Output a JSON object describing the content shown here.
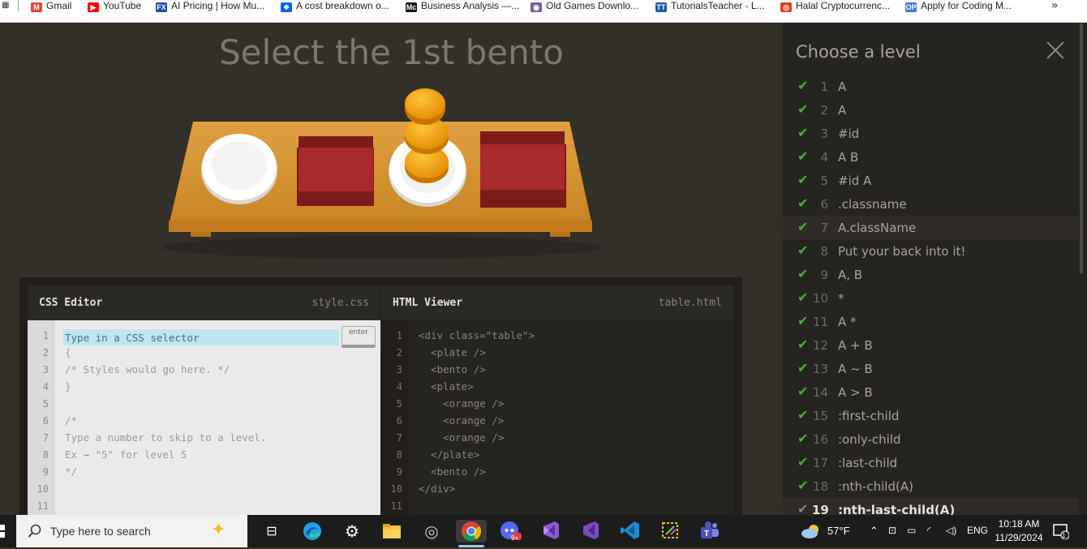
{
  "bookmarks": [
    {
      "label": "Gmail",
      "icon": "gmail-icon",
      "color": "#ea4335",
      "glyph": "M"
    },
    {
      "label": "YouTube",
      "icon": "youtube-icon",
      "color": "#ff0000",
      "glyph": "▶"
    },
    {
      "label": "AI Pricing | How Mu...",
      "icon": "fx-icon",
      "color": "#1a4fa0",
      "glyph": "FX"
    },
    {
      "label": "A cost breakdown o...",
      "icon": "dropbox-icon",
      "color": "#0061fe",
      "glyph": "❖"
    },
    {
      "label": "Business Analysis —...",
      "icon": "mc-icon",
      "color": "#111111",
      "glyph": "Mc"
    },
    {
      "label": "Old Games Downlo...",
      "icon": "old-games-icon",
      "color": "#7a5aa0",
      "glyph": "◉"
    },
    {
      "label": "TutorialsTeacher - L...",
      "icon": "tutorialsteacher-icon",
      "color": "#1c5bab",
      "glyph": "TT"
    },
    {
      "label": "Halal Cryptocurrenc...",
      "icon": "crypto-icon",
      "color": "#e0401f",
      "glyph": "◎"
    },
    {
      "label": "Apply for Coding M...",
      "icon": "op-icon",
      "color": "#3b7dd8",
      "glyph": "OP"
    }
  ],
  "bookmarks_more": "»",
  "level_title": "Select the 1st bento",
  "css_editor": {
    "title": "CSS Editor",
    "file": "style.css",
    "placeholder": "Type in a CSS selector",
    "enter_label": "enter",
    "line_numbers": [
      "1",
      "2",
      "3",
      "4",
      "5",
      "6",
      "7",
      "8",
      "9",
      "10",
      "11"
    ],
    "lines": [
      "",
      "{",
      "/* Styles would go here. */",
      "}",
      "",
      "/*",
      "Type a number to skip to a level.",
      "Ex → \"5\" for level 5",
      "*/",
      "",
      ""
    ]
  },
  "html_viewer": {
    "title": "HTML Viewer",
    "file": "table.html",
    "line_numbers": [
      "1",
      "2",
      "3",
      "4",
      "5",
      "6",
      "7",
      "8",
      "9",
      "10",
      "11"
    ],
    "lines": [
      "<div class=\"table\">",
      "  <plate />",
      "  <bento />",
      "  <plate>",
      "    <orange />",
      "    <orange />",
      "    <orange />",
      "  </plate>",
      "  <bento />",
      "</div>",
      ""
    ]
  },
  "sidebar": {
    "title": "Choose a level",
    "levels": [
      {
        "num": "1",
        "name": "A"
      },
      {
        "num": "2",
        "name": "A"
      },
      {
        "num": "3",
        "name": "#id"
      },
      {
        "num": "4",
        "name": "A  B"
      },
      {
        "num": "5",
        "name": "#id  A"
      },
      {
        "num": "6",
        "name": ".classname"
      },
      {
        "num": "7",
        "name": "A.className"
      },
      {
        "num": "8",
        "name": "Put your back into it!"
      },
      {
        "num": "9",
        "name": "A, B"
      },
      {
        "num": "10",
        "name": "*"
      },
      {
        "num": "11",
        "name": "A  *"
      },
      {
        "num": "12",
        "name": "A + B"
      },
      {
        "num": "13",
        "name": "A ~ B"
      },
      {
        "num": "14",
        "name": "A > B"
      },
      {
        "num": "15",
        "name": ":first-child"
      },
      {
        "num": "16",
        "name": ":only-child"
      },
      {
        "num": "17",
        "name": ":last-child"
      },
      {
        "num": "18",
        "name": ":nth-child(A)"
      },
      {
        "num": "19",
        "name": ":nth-last-child(A)"
      }
    ],
    "check_glyph": "✔"
  },
  "taskbar": {
    "search_placeholder": "Type here to search",
    "weather": "57°F",
    "language": "ENG",
    "time": "10:18 AM",
    "date": "11/29/2024",
    "notification_count": "1",
    "edge_badge": "9+"
  },
  "colors": {
    "background": "#332f29",
    "sidebar": "#262420",
    "check": "#4cae3c",
    "table": "#d8922e",
    "bento": "#9a2424",
    "orange": "#f5a20a"
  }
}
